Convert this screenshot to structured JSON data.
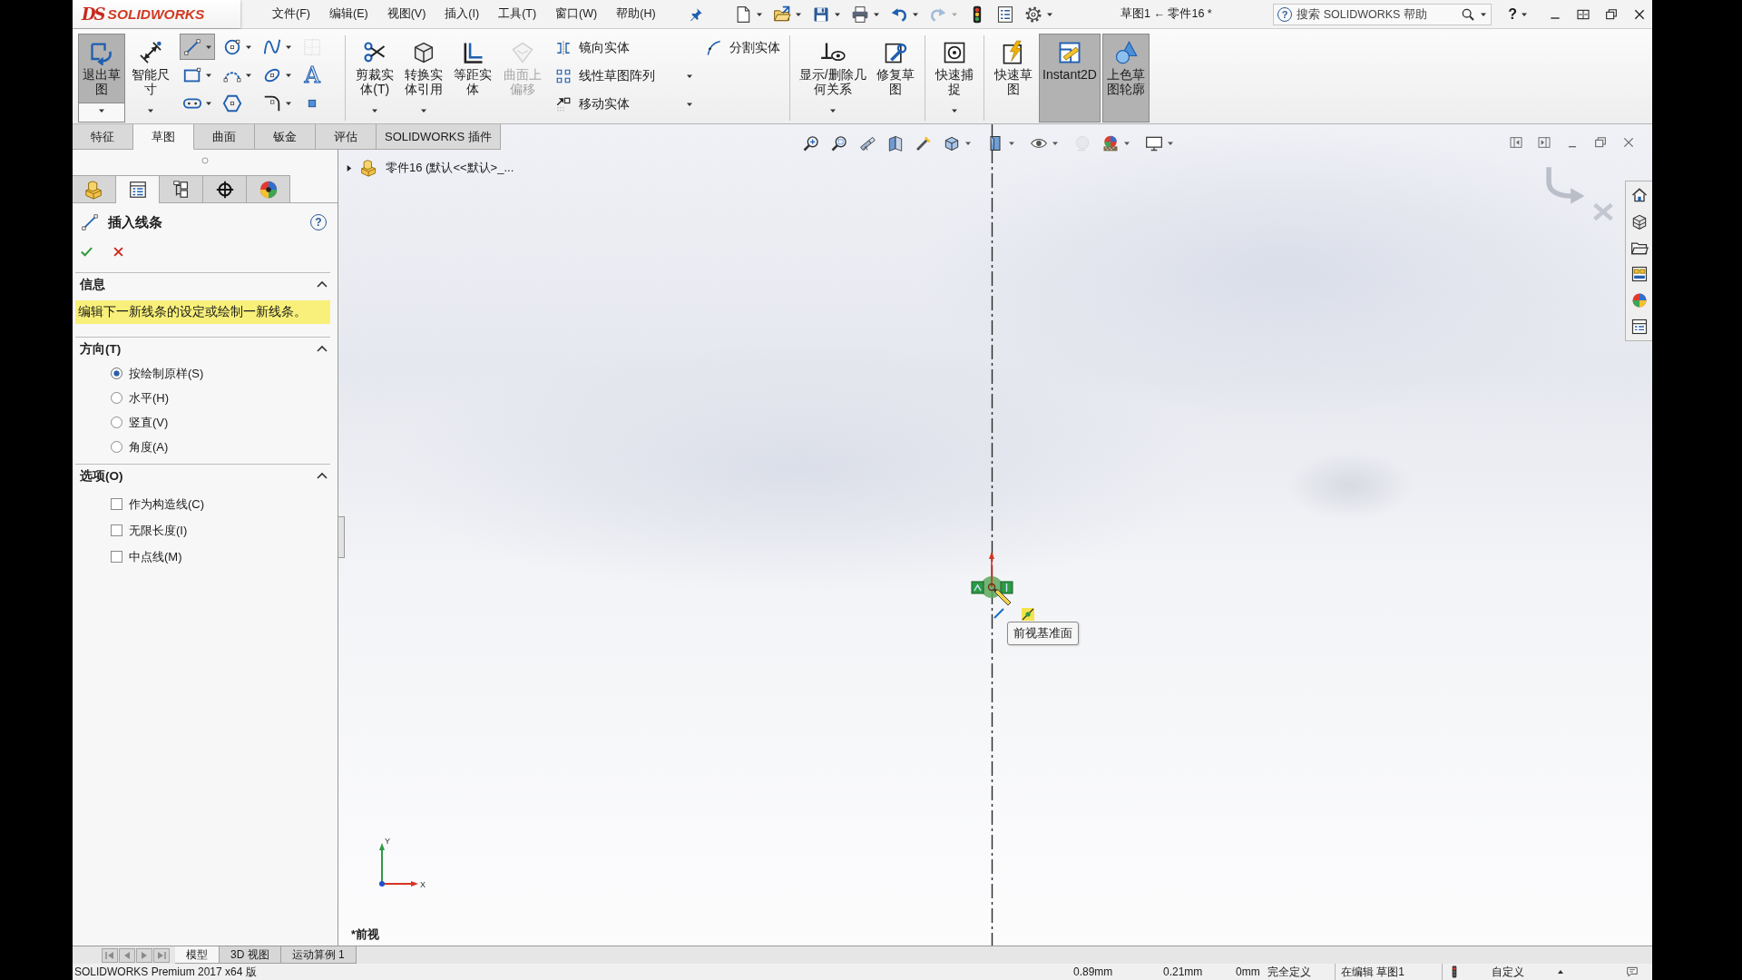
{
  "logo": {
    "mark": "DS",
    "name": "SOLIDWORKS"
  },
  "menu": [
    "文件(F)",
    "编辑(E)",
    "视图(V)",
    "插入(I)",
    "工具(T)",
    "窗口(W)",
    "帮助(H)"
  ],
  "quick_access": [
    {
      "kind": "new",
      "dropdown": true,
      "disabled": false
    },
    {
      "kind": "open",
      "dropdown": true,
      "disabled": false
    },
    {
      "kind": "save",
      "dropdown": true,
      "disabled": false
    },
    {
      "kind": "print",
      "dropdown": true,
      "disabled": false
    },
    {
      "kind": "undo",
      "dropdown": true,
      "disabled": false
    },
    {
      "kind": "redo",
      "dropdown": true,
      "disabled": true
    },
    {
      "kind": "rebuild",
      "dropdown": false,
      "disabled": false
    },
    {
      "kind": "properties",
      "dropdown": false,
      "disabled": false
    },
    {
      "kind": "options",
      "dropdown": true,
      "disabled": false
    }
  ],
  "window": {
    "title": "草图1 ← 零件16 *",
    "search_glyph": "?",
    "search_placeholder": "搜索 SOLIDWORKS 帮助",
    "help": "?"
  },
  "ribbon": [
    {
      "kind": "buttons",
      "items": [
        {
          "kind": "exit-sketch",
          "label": "退出草图",
          "selected": true,
          "disabled": false,
          "dropdown": true
        },
        {
          "kind": "smart-dimension",
          "label": "智能尺寸",
          "selected": false,
          "disabled": false,
          "dropdown": true
        }
      ]
    },
    {
      "kind": "tools",
      "items": [
        {
          "kind": "line",
          "selected": true,
          "disabled": false,
          "dropdown": true
        },
        {
          "kind": "circle",
          "selected": false,
          "disabled": false,
          "dropdown": true
        },
        {
          "kind": "spline",
          "selected": false,
          "disabled": false,
          "dropdown": true
        },
        {
          "kind": "plane",
          "selected": false,
          "disabled": true,
          "dropdown": false
        },
        {
          "kind": "rectangle",
          "selected": false,
          "disabled": false,
          "dropdown": true
        },
        {
          "kind": "arc",
          "selected": false,
          "disabled": false,
          "dropdown": true
        },
        {
          "kind": "ellipse",
          "selected": false,
          "disabled": false,
          "dropdown": true
        },
        {
          "kind": "text",
          "glyph": "A",
          "selected": false,
          "disabled": false,
          "dropdown": false
        },
        {
          "kind": "slot",
          "selected": false,
          "disabled": false,
          "dropdown": true
        },
        {
          "kind": "polygon",
          "selected": false,
          "disabled": false,
          "dropdown": false
        },
        {
          "kind": "fillet",
          "selected": false,
          "disabled": false,
          "dropdown": true
        },
        {
          "kind": "point",
          "selected": false,
          "disabled": false,
          "dropdown": false
        }
      ]
    },
    {
      "kind": "separator"
    },
    {
      "kind": "buttons",
      "items": [
        {
          "kind": "trim",
          "label": "剪裁实体(T)",
          "selected": false,
          "disabled": false,
          "dropdown": true
        },
        {
          "kind": "convert",
          "label": "转换实体引用",
          "selected": false,
          "disabled": false,
          "dropdown": true
        },
        {
          "kind": "offset",
          "label": "等距实体",
          "selected": false,
          "disabled": false,
          "dropdown": false
        },
        {
          "kind": "surface-offset",
          "label": "曲面上偏移",
          "selected": false,
          "disabled": true,
          "dropdown": false
        }
      ]
    },
    {
      "kind": "list",
      "items": [
        {
          "kind": "mirror",
          "label": "镜向实体",
          "dropdown": false
        },
        {
          "kind": "pattern",
          "label": "线性草图阵列",
          "dropdown": true
        },
        {
          "kind": "move",
          "label": "移动实体",
          "dropdown": true
        }
      ]
    },
    {
      "kind": "list",
      "items": [
        {
          "kind": "split",
          "label": "分割实体",
          "dropdown": false
        }
      ]
    },
    {
      "kind": "separator"
    },
    {
      "kind": "buttons",
      "items": [
        {
          "kind": "relations",
          "label": "显示/删除几何关系",
          "selected": false,
          "disabled": false,
          "dropdown": true
        },
        {
          "kind": "repair",
          "label": "修复草图",
          "selected": false,
          "disabled": false,
          "dropdown": false
        }
      ]
    },
    {
      "kind": "separator"
    },
    {
      "kind": "buttons",
      "items": [
        {
          "kind": "snap",
          "label": "快速捕捉",
          "selected": false,
          "disabled": false,
          "dropdown": true
        }
      ]
    },
    {
      "kind": "separator"
    },
    {
      "kind": "buttons",
      "items": [
        {
          "kind": "rapid",
          "label": "快速草图",
          "selected": false,
          "disabled": false,
          "dropdown": false
        },
        {
          "kind": "instant2d",
          "label": "Instant2D",
          "selected": true,
          "disabled": false,
          "dropdown": false
        },
        {
          "kind": "shaded",
          "label": "上色草图轮廓",
          "selected": true,
          "disabled": false,
          "dropdown": false
        }
      ]
    }
  ],
  "command_tabs": [
    {
      "label": "特征",
      "selected": false
    },
    {
      "label": "草图",
      "selected": true
    },
    {
      "label": "曲面",
      "selected": false
    },
    {
      "label": "钣金",
      "selected": false
    },
    {
      "label": "评估",
      "selected": false
    },
    {
      "label": "SOLIDWORKS 插件",
      "selected": false
    }
  ],
  "manager_tabs": [
    {
      "kind": "feature-tree",
      "selected": false
    },
    {
      "kind": "property",
      "selected": true
    },
    {
      "kind": "configuration",
      "selected": false
    },
    {
      "kind": "dimxpert",
      "selected": false
    },
    {
      "kind": "display",
      "selected": false
    }
  ],
  "property_manager": {
    "title": "插入线条",
    "help": "?",
    "sections": [
      {
        "kind": "message",
        "title": "信息",
        "expanded": true,
        "message": "编辑下一新线条的设定或绘制一新线条。"
      },
      {
        "kind": "radio",
        "title": "方向(T)",
        "expanded": true,
        "options": [
          {
            "label": "按绘制原样(S)",
            "selected": true
          },
          {
            "label": "水平(H)",
            "selected": false
          },
          {
            "label": "竖直(V)",
            "selected": false
          },
          {
            "label": "角度(A)",
            "selected": false
          }
        ]
      },
      {
        "kind": "checkbox",
        "title": "选项(O)",
        "expanded": true,
        "options": [
          {
            "label": "作为构造线(C)",
            "checked": false
          },
          {
            "label": "无限长度(I)",
            "checked": false
          },
          {
            "label": "中点线(M)",
            "checked": false
          }
        ]
      }
    ]
  },
  "graphics": {
    "tree_item": {
      "expanded": false,
      "label": "零件16 (默认<<默认>_..."
    },
    "view_toolbar": [
      {
        "kind": "zoom-fit",
        "dropdown": false,
        "disabled": false
      },
      {
        "kind": "zoom-area",
        "dropdown": false,
        "disabled": false
      },
      {
        "kind": "previous-view",
        "dropdown": false,
        "disabled": false
      },
      {
        "kind": "section-view",
        "dropdown": false,
        "disabled": false
      },
      {
        "kind": "annotation",
        "dropdown": false,
        "disabled": false
      },
      {
        "kind": "orientation",
        "dropdown": true,
        "disabled": false
      },
      {
        "kind": "display-style",
        "dropdown": true,
        "disabled": false
      },
      {
        "kind": "hide-show",
        "dropdown": true,
        "disabled": false
      },
      {
        "kind": "appearance",
        "dropdown": false,
        "disabled": true
      },
      {
        "kind": "scene",
        "dropdown": true,
        "disabled": false
      },
      {
        "kind": "view-settings",
        "dropdown": true,
        "disabled": false
      }
    ],
    "tooltip": "前视基准面",
    "view_label": "*前视",
    "triad": {
      "x": "X",
      "y": "Y"
    }
  },
  "model_tabs": [
    {
      "label": "模型",
      "selected": true
    },
    {
      "label": "3D 视图",
      "selected": false
    },
    {
      "label": "运动算例 1",
      "selected": false
    }
  ],
  "status_bar": {
    "product": "SOLIDWORKS Premium 2017 x64 版",
    "coordinate_x": "0.89mm",
    "coordinate_y": "0.21mm",
    "coordinate_z": "0mm",
    "sketch_state": "完全定义",
    "editing": "在编辑 草图1",
    "units": "自定义"
  }
}
